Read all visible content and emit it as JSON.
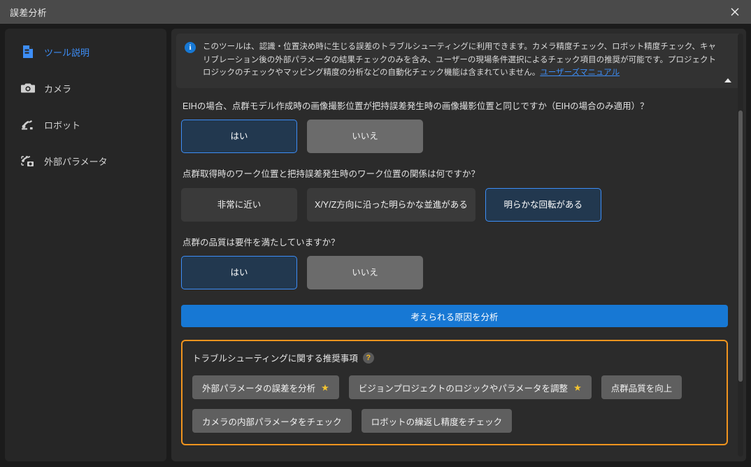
{
  "window": {
    "title": "誤差分析",
    "close_label": "✕"
  },
  "sidebar": {
    "items": [
      {
        "label": "ツール説明",
        "icon": "document-icon",
        "active": true
      },
      {
        "label": "カメラ",
        "icon": "camera-icon",
        "active": false
      },
      {
        "label": "ロボット",
        "icon": "robot-arm-icon",
        "active": false
      },
      {
        "label": "外部パラメータ",
        "icon": "extrinsic-parameters-icon",
        "active": false
      }
    ]
  },
  "info_banner": {
    "icon": "info-icon",
    "text_before_link": "このツールは、認識・位置決め時に生じる誤差のトラブルシューティングに利用できます。カメラ精度チェック、ロボット精度チェック、キャリブレーション後の外部パラメータの結果チェックのみを含み、ユーザーの現場条件選択によるチェック項目の推奨が可能です。プロジェクトロジックのチェックやマッピング精度の分析などの自動化チェック機能は含まれていません。",
    "link_text": "ユーザーズマニュアル",
    "collapse_icon": "chevron-up-icon"
  },
  "questions": [
    {
      "label": "EIHの場合、点群モデル作成時の画像撮影位置が把持誤差発生時の画像撮影位置と同じですか（EIHの場合のみ適用）？",
      "options": [
        {
          "label": "はい",
          "state": "selected"
        },
        {
          "label": "いいえ",
          "state": "hover"
        }
      ]
    },
    {
      "label": "点群取得時のワーク位置と把持誤差発生時のワーク位置の関係は何ですか？",
      "options": [
        {
          "label": "非常に近い",
          "state": "normal"
        },
        {
          "label": "X/Y/Z方向に沿った明らかな並進がある",
          "state": "normal"
        },
        {
          "label": "明らかな回転がある",
          "state": "selected"
        }
      ]
    },
    {
      "label": "点群の品質は要件を満たしていますか？",
      "options": [
        {
          "label": "はい",
          "state": "selected"
        },
        {
          "label": "いいえ",
          "state": "hover"
        }
      ]
    }
  ],
  "analyze_button": {
    "label": "考えられる原因を分析"
  },
  "recommendations": {
    "title": "トラブルシューティングに関する推奨事項",
    "help_icon": "help-icon",
    "help_glyph": "?",
    "star_glyph": "★",
    "rows": [
      [
        {
          "label": "外部パラメータの誤差を分析",
          "starred": true
        },
        {
          "label": "ビジョンプロジェクトのロジックやパラメータを調整",
          "starred": true
        },
        {
          "label": "点群品質を向上",
          "starred": false
        }
      ],
      [
        {
          "label": "カメラの内部パラメータをチェック",
          "starred": false
        },
        {
          "label": "ロボットの繰返し精度をチェック",
          "starred": false
        }
      ]
    ]
  },
  "colors": {
    "accent_blue": "#1778d4",
    "selected_border": "#3d8ef7",
    "orange_border": "#f0941e",
    "star_yellow": "#f4c430",
    "titlebar": "#4a4a4a"
  }
}
